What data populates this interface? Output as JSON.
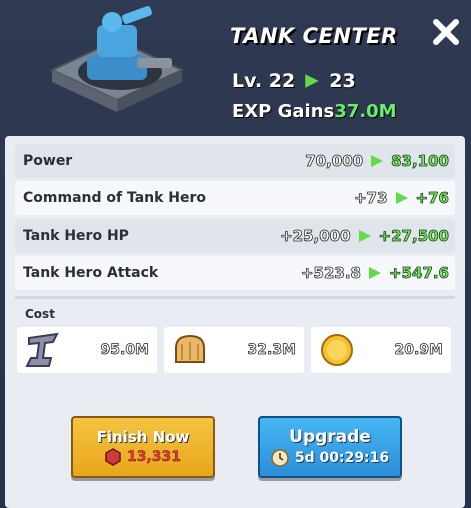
{
  "header": {
    "title": "TANK CENTER",
    "level_label": "Lv. 22",
    "level_next": "23",
    "exp_label": "EXP Gains",
    "exp_value": "37.0M"
  },
  "stats": [
    {
      "label": "Power",
      "old": "70,000",
      "new": "83,100"
    },
    {
      "label": "Command of Tank Hero",
      "old": "+73",
      "new": "+76"
    },
    {
      "label": "Tank Hero HP",
      "old": "+25,000",
      "new": "+27,500"
    },
    {
      "label": "Tank Hero Attack",
      "old": "+523.8",
      "new": "+547.6"
    }
  ],
  "cost": {
    "label": "Cost",
    "items": [
      {
        "icon": "iron-icon",
        "value": "95.0M"
      },
      {
        "icon": "bread-icon",
        "value": "32.3M"
      },
      {
        "icon": "gold-coin-icon",
        "value": "20.9M"
      }
    ]
  },
  "buttons": {
    "finish_label": "Finish Now",
    "finish_cost": "13,331",
    "upgrade_label": "Upgrade",
    "upgrade_time": "5d 00:29:16"
  },
  "colors": {
    "accent_green": "#66ef6a",
    "finish_yellow": "#f5c340",
    "upgrade_blue": "#2b8fd8"
  }
}
